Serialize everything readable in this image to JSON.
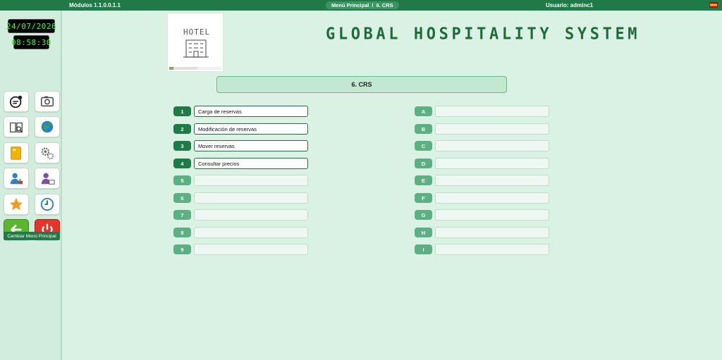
{
  "topbar": {
    "version": "Módulos 1.1.0.0.1.1",
    "breadcrumb": [
      "Menú Principal",
      "/",
      "6. CRS"
    ],
    "user": "Usuario: adminc1"
  },
  "clock": {
    "date": "24/07/2026",
    "time": "08:58:30"
  },
  "sidebar": {
    "change_menu_label": "Cambiar Menú Principal",
    "icons": [
      "chat-add-icon",
      "camera-icon",
      "manual-icon",
      "globe-icon",
      "folder-icon",
      "gears-icon",
      "user-chart-icon",
      "user-card-icon",
      "star-icon",
      "clock-icon",
      "back-arrow-icon",
      "power-icon"
    ]
  },
  "logo": {
    "text": "HOTEL"
  },
  "app_title": "GLOBAL HOSPITALITY SYSTEM",
  "section": {
    "title": "6. CRS"
  },
  "left_options": [
    {
      "key": "1",
      "label": "Carga de reservas"
    },
    {
      "key": "2",
      "label": "Modificación de reservas"
    },
    {
      "key": "3",
      "label": "Mover reservas"
    },
    {
      "key": "4",
      "label": "Consultar precios"
    },
    {
      "key": "5",
      "label": ""
    },
    {
      "key": "6",
      "label": ""
    },
    {
      "key": "7",
      "label": ""
    },
    {
      "key": "8",
      "label": ""
    },
    {
      "key": "9",
      "label": ""
    }
  ],
  "right_options": [
    {
      "key": "A",
      "label": ""
    },
    {
      "key": "B",
      "label": ""
    },
    {
      "key": "C",
      "label": ""
    },
    {
      "key": "D",
      "label": ""
    },
    {
      "key": "E",
      "label": ""
    },
    {
      "key": "F",
      "label": ""
    },
    {
      "key": "G",
      "label": ""
    },
    {
      "key": "H",
      "label": ""
    },
    {
      "key": "I",
      "label": ""
    }
  ],
  "colors": {
    "primary": "#1f7a47",
    "inactive": "#5db083",
    "background": "#d9f2e4",
    "clock_text": "#35ff3a"
  }
}
